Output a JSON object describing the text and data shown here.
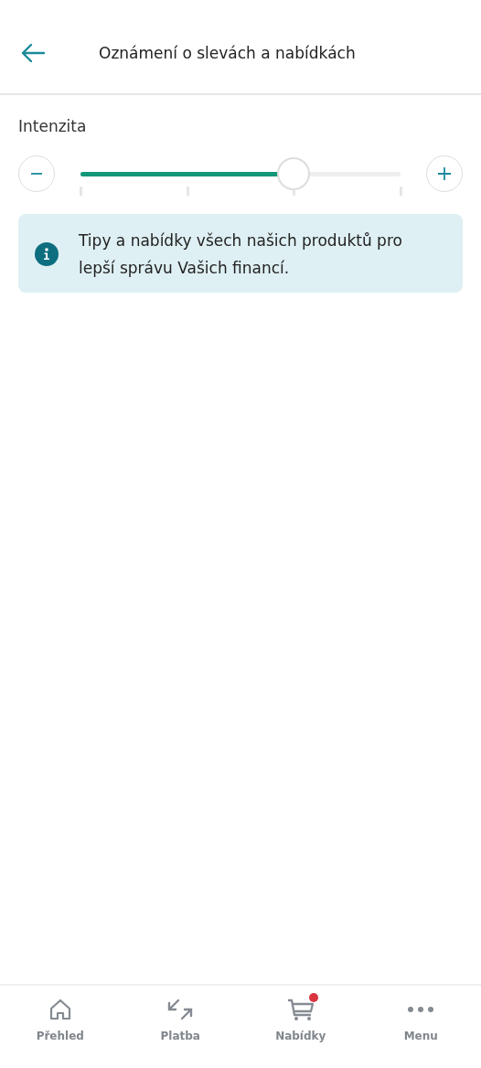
{
  "header": {
    "title": "Oznámení o slevách a nabídkách"
  },
  "intensity": {
    "label": "Intenzita",
    "level": 0.667
  },
  "info": {
    "text": "Tipy a nabídky všech našich produktů pro lepší správu Vašich financí."
  },
  "nav": [
    {
      "label": "Přehled",
      "kind": "home",
      "badge": false
    },
    {
      "label": "Platba",
      "kind": "transfer",
      "badge": false
    },
    {
      "label": "Nabídky",
      "kind": "cart",
      "badge": true
    },
    {
      "label": "Menu",
      "kind": "dots",
      "badge": false
    }
  ]
}
